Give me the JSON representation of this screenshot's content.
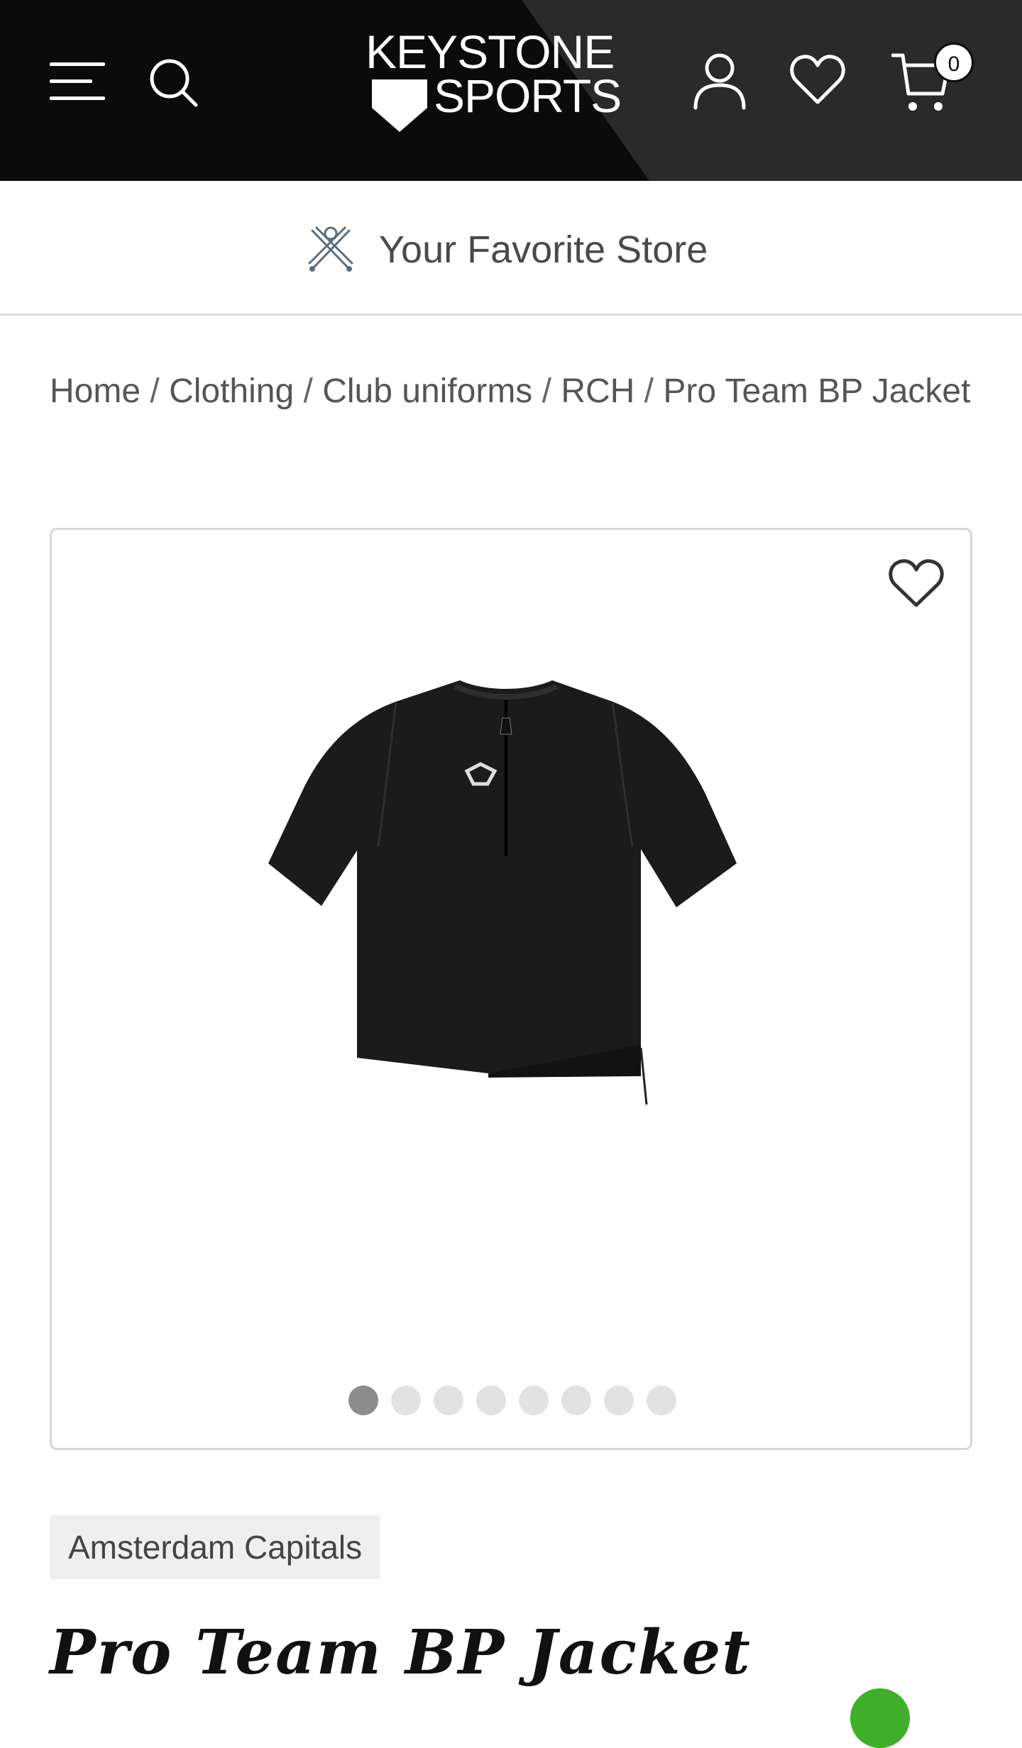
{
  "header": {
    "logo_line1": "KEYSTONE",
    "logo_line2": "SPORTS",
    "cart_count": "0",
    "icons": [
      "menu-icon",
      "search-icon",
      "account-icon",
      "heart-icon",
      "cart-icon"
    ]
  },
  "promo": {
    "text": "Your Favorite Store",
    "icon": "crossed-bats-icon"
  },
  "breadcrumb": {
    "items": [
      "Home",
      "Clothing",
      "Club uniforms",
      "RCH",
      "Pro Team BP Jacket"
    ],
    "separator": "/"
  },
  "gallery": {
    "image_count": 8,
    "active_index": 0,
    "wishlist_icon": "heart-icon"
  },
  "product": {
    "vendor": "Amsterdam Capitals",
    "title": "Pro Team BP Jacket"
  },
  "colors": {
    "header_bg": "#0b0b0b",
    "header_accent": "#2a2a2a",
    "chat_green": "#3fae2a"
  }
}
